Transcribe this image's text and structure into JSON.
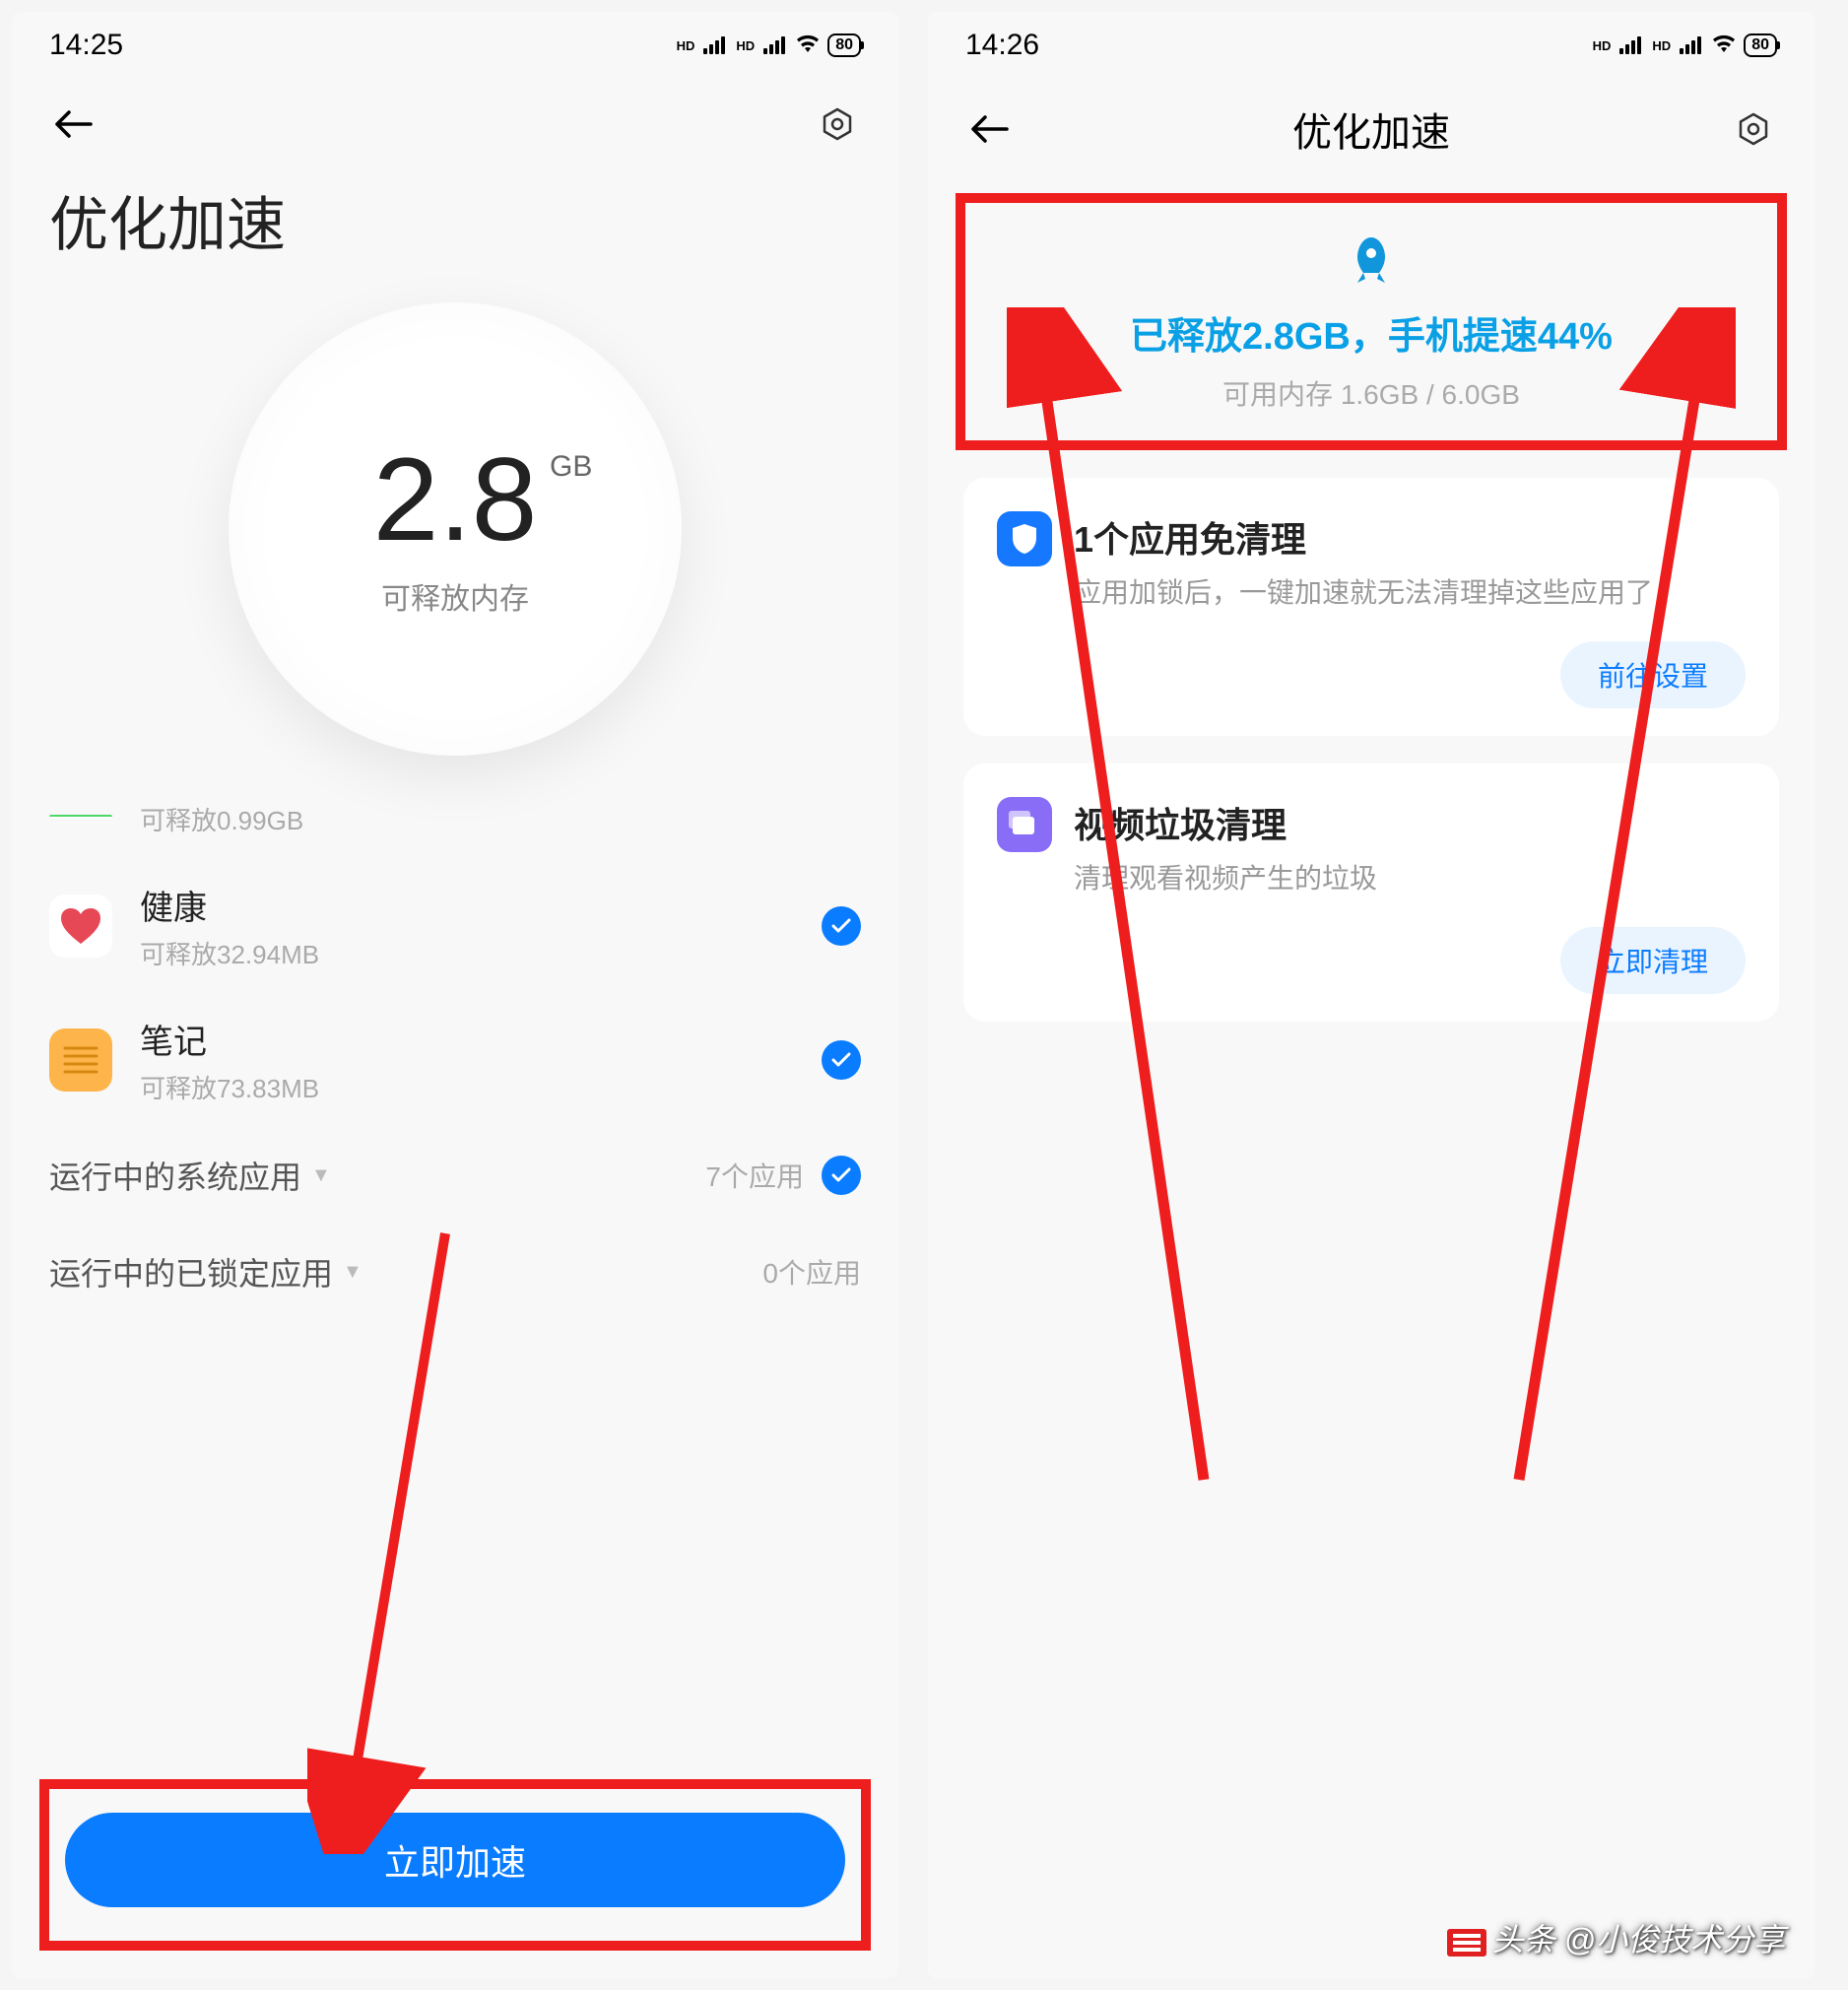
{
  "left": {
    "status": {
      "time": "14:25",
      "battery": "80"
    },
    "title": "优化加速",
    "gauge": {
      "value": "2.8",
      "unit": "GB",
      "subtitle": "可释放内存"
    },
    "apps": {
      "partial": {
        "sub": "可释放0.99GB"
      },
      "health": {
        "name": "健康",
        "sub": "可释放32.94MB"
      },
      "notes": {
        "name": "笔记",
        "sub": "可释放73.83MB"
      }
    },
    "sections": {
      "system": {
        "title": "运行中的系统应用",
        "count": "7个应用"
      },
      "locked": {
        "title": "运行中的已锁定应用",
        "count": "0个应用"
      }
    },
    "button": "立即加速"
  },
  "right": {
    "status": {
      "time": "14:26",
      "battery": "80"
    },
    "title": "优化加速",
    "result": {
      "main": "已释放2.8GB，手机提速44%",
      "sub": "可用内存 1.6GB / 6.0GB"
    },
    "cards": {
      "locked": {
        "title": "1个应用免清理",
        "desc": "应用加锁后，一键加速就无法清理掉这些应用了",
        "action": "前往设置"
      },
      "video": {
        "title": "视频垃圾清理",
        "desc": "清理观看视频产生的垃圾",
        "action": "立即清理"
      }
    }
  },
  "watermark": "头条 @小俊技术分享"
}
